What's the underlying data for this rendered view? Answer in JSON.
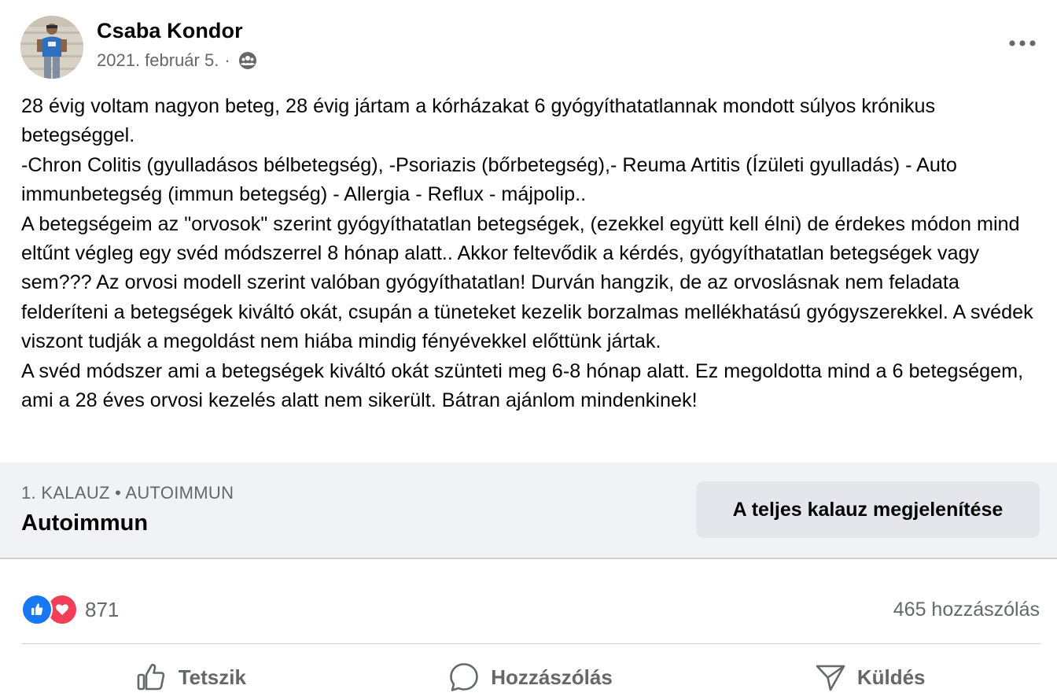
{
  "post": {
    "author": "Csaba Kondor",
    "date": "2021. február 5.",
    "separator": "·",
    "audience_icon": "friends-globe-icon",
    "more_icon": "more-horizontal-icon",
    "body_paragraphs": [
      "28 évig voltam nagyon beteg, 28 évig jártam a kórházakat 6 gyógyíthatatlannak mondott súlyos krónikus betegséggel.",
      "-Chron Colitis (gyulladásos bélbetegség), -Psoriazis (bőrbetegség),- Reuma Artitis (Ízületi gyulladás) - Auto immunbetegség (immun betegség) - Allergia - Reflux - májpolip..",
      "A betegségeim az \"orvosok\" szerint gyógyíthatatlan betegségek, (ezekkel együtt kell élni) de érdekes módon mind eltűnt végleg egy svéd módszerrel 8 hónap alatt.. Akkor feltevődik a kérdés, gyógyíthatatlan betegségek vagy sem??? Az orvosi modell szerint valóban gyógyíthatatlan! Durván hangzik, de az orvoslásnak nem feladata felderíteni a betegségek kiváltó okát, csupán a tüneteket kezelik borzalmas mellékhatású gyógyszerekkel. A svédek viszont tudják a megoldást nem hiába mindig fényévekkel előttünk jártak.",
      "A svéd módszer ami a betegségek kiváltó okát szünteti meg 6-8 hónap alatt.  Ez megoldotta mind a 6 betegségem, ami a 28 éves orvosi kezelés alatt nem sikerült. Bátran ajánlom mindenkinek!"
    ]
  },
  "guide": {
    "kicker": "1. KALAUZ • AUTOIMMUN",
    "title": "Autoimmun",
    "button_label": "A teljes kalauz megjelenítése"
  },
  "stats": {
    "reaction_icons": [
      "like-reaction-icon",
      "love-reaction-icon"
    ],
    "reaction_count": "871",
    "comments_label": "465 hozzászólás"
  },
  "actions": {
    "like_label": "Tetszik",
    "comment_label": "Hozzászólás",
    "send_label": "Küldés"
  },
  "colors": {
    "text_primary": "#050505",
    "text_secondary": "#65676b",
    "like_blue": "#1877f2",
    "love_red": "#f33e58",
    "guide_background": "#f0f2f5",
    "button_background": "#e4e6eb"
  }
}
